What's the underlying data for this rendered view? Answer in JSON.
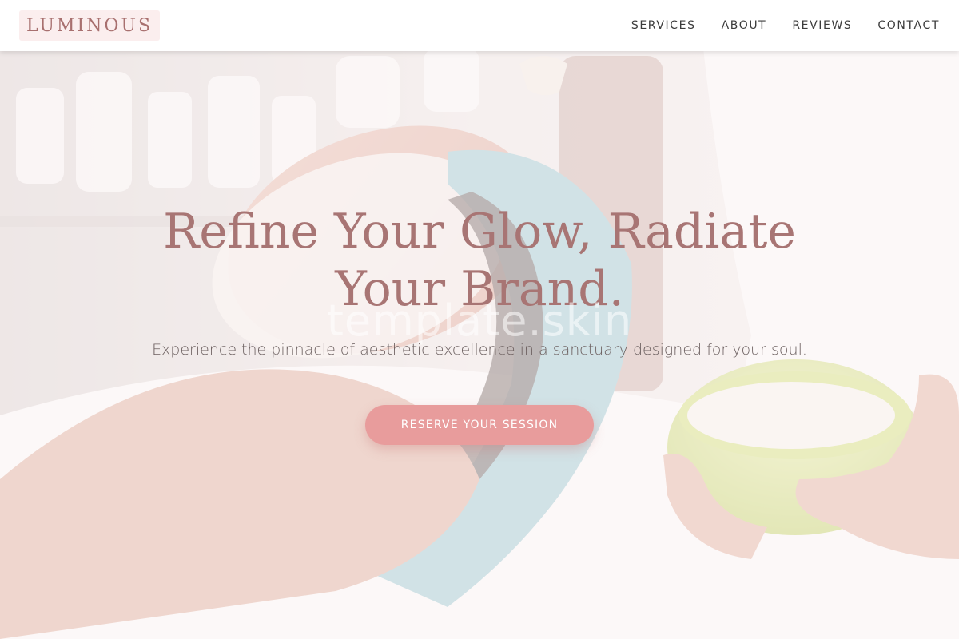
{
  "header": {
    "logo": "LUMINOUS",
    "nav": [
      {
        "label": "SERVICES"
      },
      {
        "label": "ABOUT"
      },
      {
        "label": "REVIEWS"
      },
      {
        "label": "CONTACT"
      }
    ]
  },
  "hero": {
    "title_line1": "Refine Your Glow, Radiate",
    "title_line2": "Your Brand.",
    "watermark": "template.skin",
    "subtitle": "Experience the pinnacle of aesthetic excellence in a sanctuary designed for your soul.",
    "cta_label": "RESERVE YOUR SESSION"
  },
  "colors": {
    "accent": "#e89c9c",
    "title": "#a87574",
    "logo_bg": "#fbeeee"
  }
}
